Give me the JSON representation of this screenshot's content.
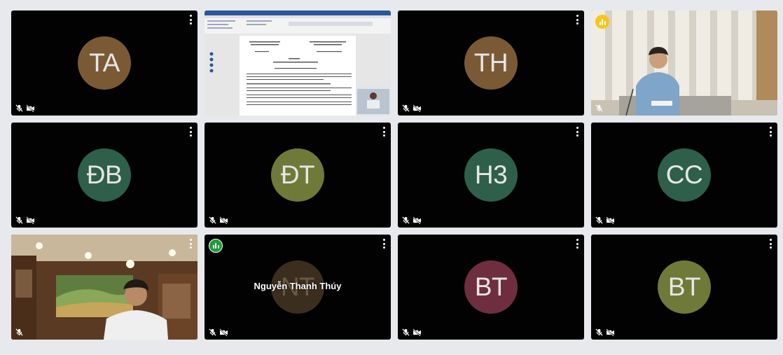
{
  "colors": {
    "tile_bg": "#020202",
    "page_bg": "#e8e9ec",
    "speaking_yellow": "#f7c51a",
    "speaking_green": "#1f9d3a"
  },
  "tiles": [
    {
      "kind": "avatar",
      "initials": "TA",
      "avatar_color": "#7a5a34"
    },
    {
      "kind": "screen-share"
    },
    {
      "kind": "avatar",
      "initials": "TH",
      "avatar_color": "#7a5a34"
    },
    {
      "kind": "video",
      "speaking_badge": "yellow"
    },
    {
      "kind": "avatar",
      "initials": "ĐB",
      "avatar_color": "#2e5f4b"
    },
    {
      "kind": "avatar",
      "initials": "ĐT",
      "avatar_color": "#6f7a39"
    },
    {
      "kind": "avatar",
      "initials": "H3",
      "avatar_color": "#2e5f4b"
    },
    {
      "kind": "avatar",
      "initials": "CC",
      "avatar_color": "#2e5f4b"
    },
    {
      "kind": "video"
    },
    {
      "kind": "avatar-named",
      "initials": "NT",
      "avatar_color": "#3b2e1f",
      "name": "Nguyễn Thanh Thúy",
      "speaking_badge": "green"
    },
    {
      "kind": "avatar",
      "initials": "BT",
      "avatar_color": "#6e2e40"
    },
    {
      "kind": "avatar",
      "initials": "BT",
      "avatar_color": "#6f7a39"
    }
  ],
  "icons": {
    "mic": "mic-off-icon",
    "camera": "camera-off-icon",
    "menu": "more-vert-icon",
    "speaking": "audio-level-icon"
  }
}
